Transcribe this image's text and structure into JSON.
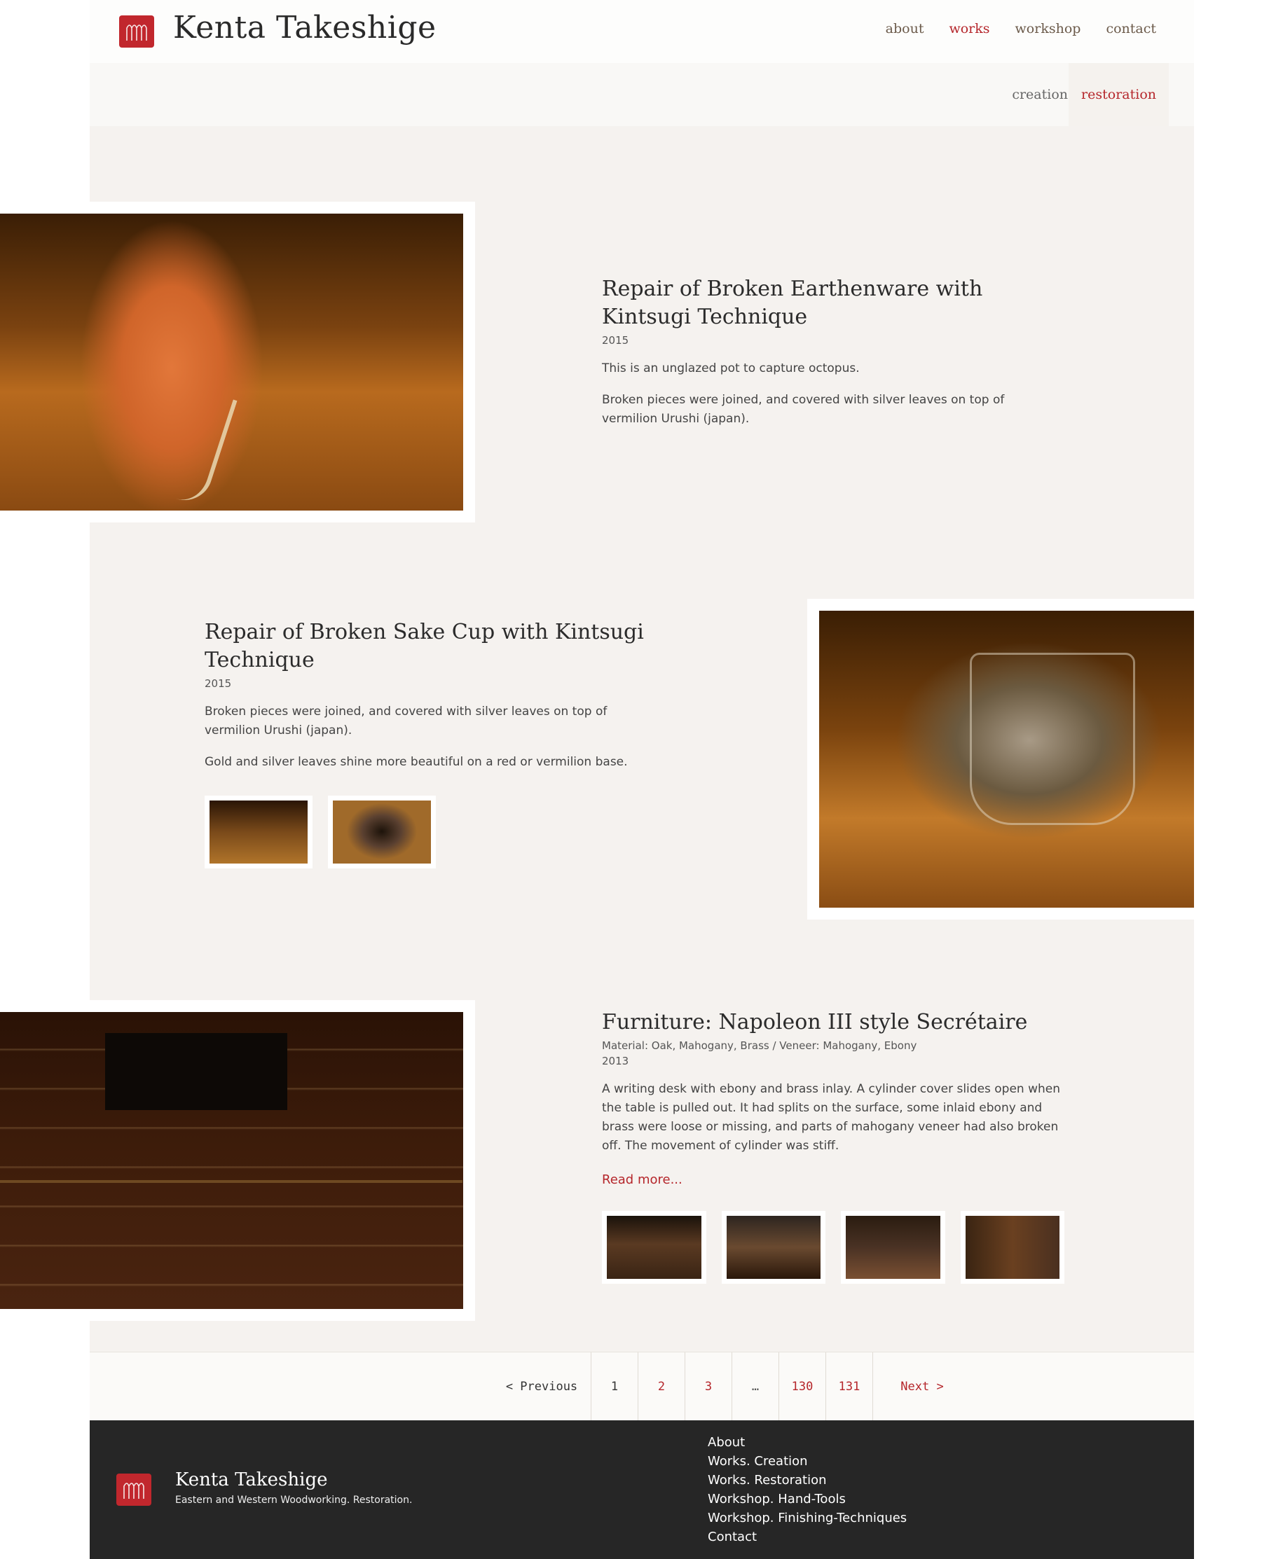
{
  "header": {
    "site_title": "Kenta Takeshige",
    "nav": [
      "about",
      "works",
      "workshop",
      "contact"
    ],
    "active_nav": "works"
  },
  "subnav": {
    "tabs": [
      "creation",
      "restoration"
    ],
    "active_tab": "restoration"
  },
  "entries": [
    {
      "title": "Repair of Broken Earthenware with Kintsugi Technique",
      "year": "2015",
      "paragraphs": [
        "This is an unglazed pot to capture octopus.",
        "Broken pieces were joined, and covered with silver leaves on top of vermilion Urushi (japan)."
      ]
    },
    {
      "title": "Repair of Broken Sake Cup with Kintsugi Technique",
      "year": "2015",
      "paragraphs": [
        "Broken pieces were joined, and covered with silver leaves on top of vermilion Urushi (japan).",
        "Gold and silver leaves shine more beautiful on a red or vermilion base."
      ]
    },
    {
      "title": "Furniture: Napoleon III style Secrétaire",
      "material": "Material: Oak, Mahogany, Brass / Veneer: Mahogany, Ebony",
      "year": "2013",
      "paragraphs": [
        "A writing desk with ebony and brass inlay. A cylinder cover slides open when the table is pulled out. It had splits on the surface, some inlaid ebony and brass were loose or missing, and parts of mahogany veneer had also broken off. The movement of cylinder was stiff."
      ],
      "read_more": "Read more..."
    }
  ],
  "pagination": {
    "prev": "< Previous",
    "pages": [
      "1",
      "2",
      "3"
    ],
    "ellipsis": "…",
    "last_pages": [
      "130",
      "131"
    ],
    "next": "Next >"
  },
  "footer": {
    "name": "Kenta Takeshige",
    "tagline": "Eastern and Western Woodworking. Restoration.",
    "links": [
      "About",
      "Works. Creation",
      "Works. Restoration",
      "Workshop. Hand-Tools",
      "Workshop. Finishing-Techniques",
      "Contact"
    ]
  },
  "colors": {
    "accent": "#b5262b",
    "logo": "#c1272d",
    "content_bg": "#f5f2ef",
    "footer_bg": "#262626"
  }
}
